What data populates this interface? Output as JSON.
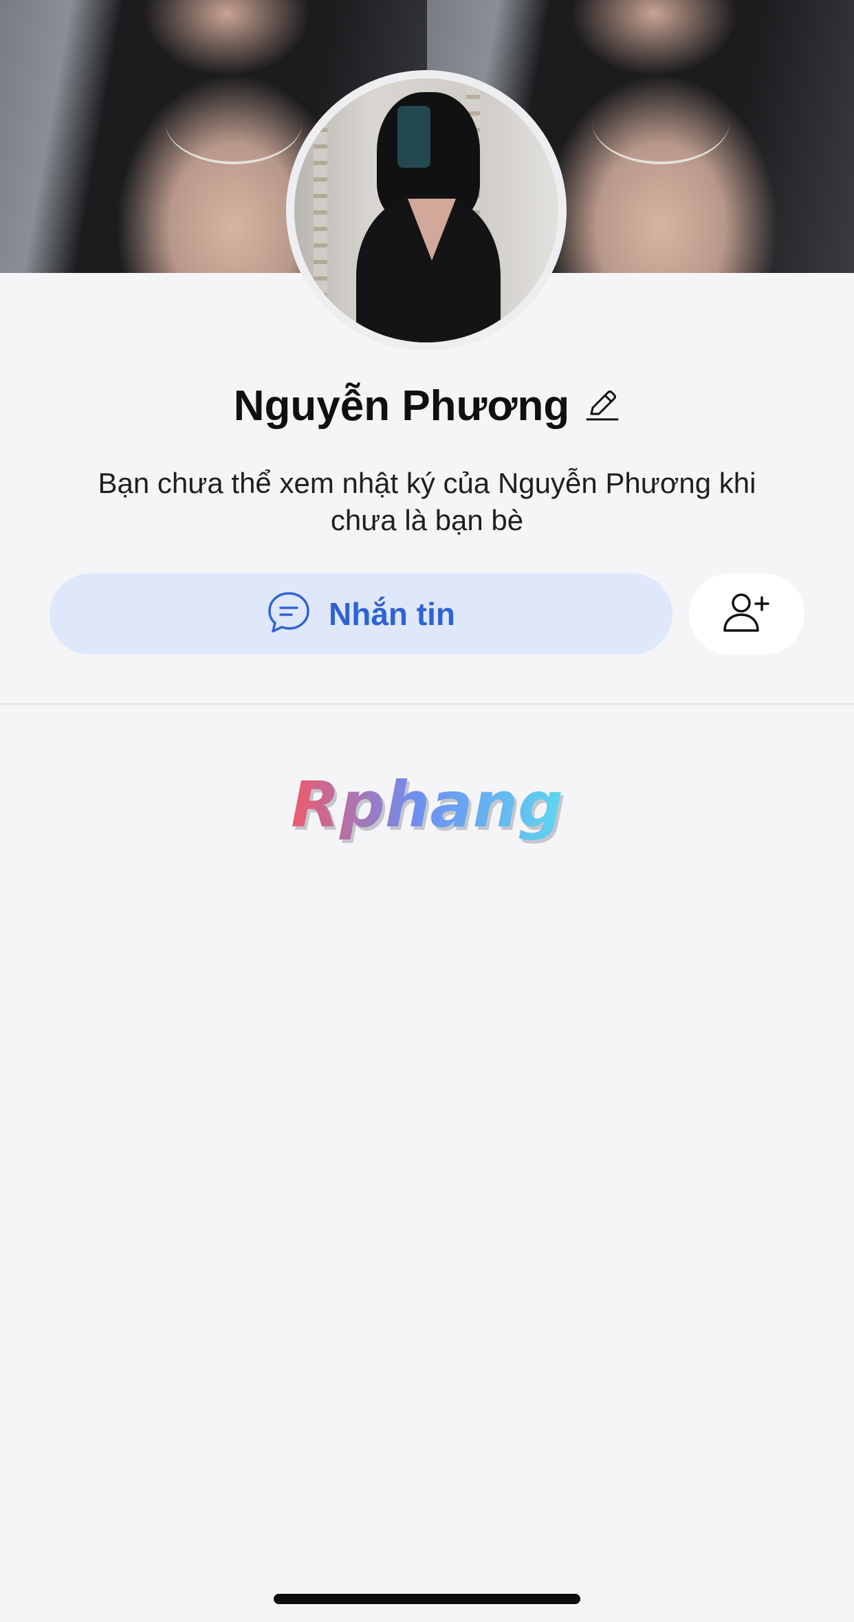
{
  "profile": {
    "name": "Nguyễn Phương",
    "privacy_note": "Bạn chưa thể xem nhật ký của Nguyễn Phương khi chưa là bạn bè"
  },
  "actions": {
    "message_label": "Nhắn tin",
    "message_icon": "chat-bubble-icon",
    "add_friend_icon": "add-friend-icon",
    "edit_icon": "pencil-icon"
  },
  "watermark": {
    "text": "Rphang"
  },
  "colors": {
    "accent": "#2e63d3",
    "message_button_bg": "#dfe7fb",
    "background": "#f5f5f8"
  }
}
